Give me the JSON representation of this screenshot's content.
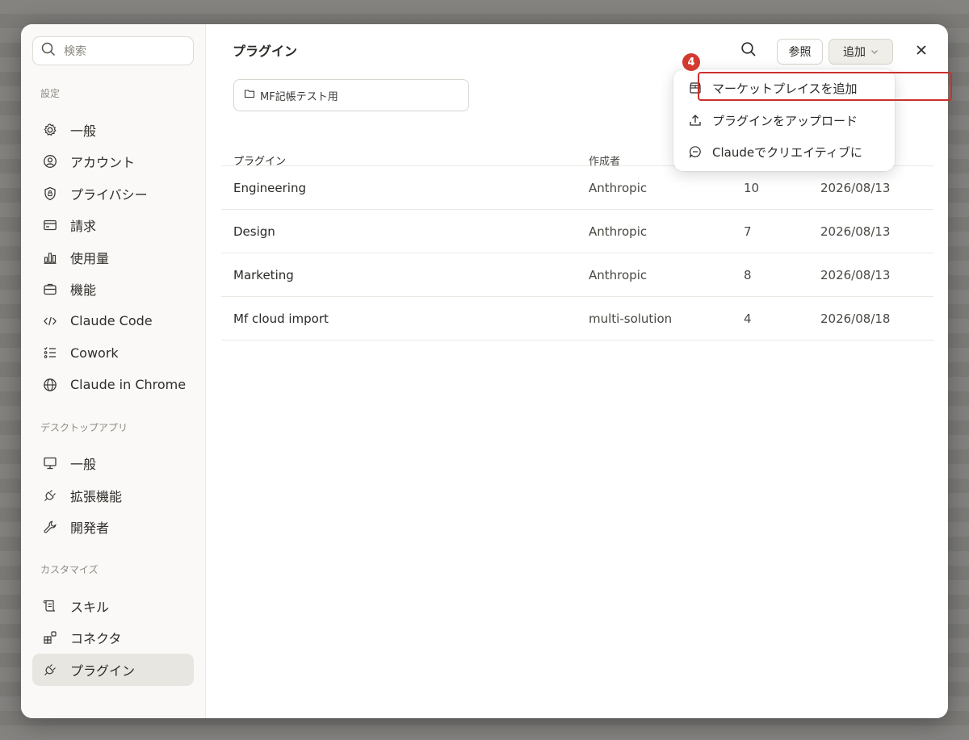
{
  "sidebar": {
    "search_placeholder": "検索",
    "section_settings": "設定",
    "settings_items": [
      {
        "label": "一般",
        "icon": "gear-icon"
      },
      {
        "label": "アカウント",
        "icon": "user-circle-icon"
      },
      {
        "label": "プライバシー",
        "icon": "shield-icon"
      },
      {
        "label": "請求",
        "icon": "credit-card-icon"
      },
      {
        "label": "使用量",
        "icon": "bar-chart-icon"
      },
      {
        "label": "機能",
        "icon": "briefcase-icon"
      },
      {
        "label": "Claude Code",
        "icon": "code-icon"
      },
      {
        "label": "Cowork",
        "icon": "checklist-icon"
      },
      {
        "label": "Claude in Chrome",
        "icon": "globe-icon"
      }
    ],
    "section_desktop": "デスクトップアプリ",
    "desktop_items": [
      {
        "label": "一般",
        "icon": "monitor-icon"
      },
      {
        "label": "拡張機能",
        "icon": "plug-icon"
      },
      {
        "label": "開発者",
        "icon": "wrench-icon"
      }
    ],
    "section_customize": "カスタマイズ",
    "customize_items": [
      {
        "label": "スキル",
        "icon": "scroll-icon"
      },
      {
        "label": "コネクタ",
        "icon": "grid-plus-icon"
      },
      {
        "label": "プラグイン",
        "icon": "plug-icon",
        "active": true
      }
    ]
  },
  "main": {
    "title": "プラグイン",
    "folder_label": "MF記帳テスト用",
    "toolbar": {
      "browse_label": "参照",
      "add_label": "追加"
    },
    "table": {
      "headers": [
        "プラグイン",
        "作成者",
        "",
        ""
      ],
      "rows": [
        {
          "name": "Engineering",
          "author": "Anthropic",
          "count": "10",
          "date": "2026/08/13"
        },
        {
          "name": "Design",
          "author": "Anthropic",
          "count": "7",
          "date": "2026/08/13"
        },
        {
          "name": "Marketing",
          "author": "Anthropic",
          "count": "8",
          "date": "2026/08/13"
        },
        {
          "name": "Mf cloud import",
          "author": "multi-solution",
          "count": "4",
          "date": "2026/08/18"
        }
      ]
    }
  },
  "dropdown": {
    "items": [
      {
        "label": "マーケットプレイスを追加",
        "icon": "store-icon"
      },
      {
        "label": "プラグインをアップロード",
        "icon": "upload-icon"
      },
      {
        "label": "Claudeでクリエイティブに",
        "icon": "chat-bubble-icon"
      }
    ]
  },
  "annotation": {
    "step_number": "4",
    "highlight_color": "#c9302c"
  }
}
